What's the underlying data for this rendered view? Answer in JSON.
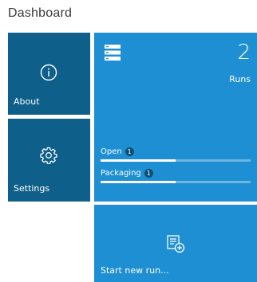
{
  "page": {
    "title": "Dashboard"
  },
  "colors": {
    "tile_dark": "#0e5f8a",
    "tile_light": "#1e8fd2",
    "badge": "#0e4f74"
  },
  "tiles": {
    "about": {
      "label": "About",
      "icon": "info-icon"
    },
    "settings": {
      "label": "Settings",
      "icon": "gear-icon"
    },
    "runs": {
      "icon": "server-icon",
      "count": "2",
      "label": "Runs",
      "stats": [
        {
          "label": "Open",
          "count": "1",
          "progress_fraction": 0.5
        },
        {
          "label": "Packaging",
          "count": "1",
          "progress_fraction": 0.5
        }
      ]
    },
    "start_new_run": {
      "label": "Start new run...",
      "icon": "new-run-icon"
    }
  }
}
